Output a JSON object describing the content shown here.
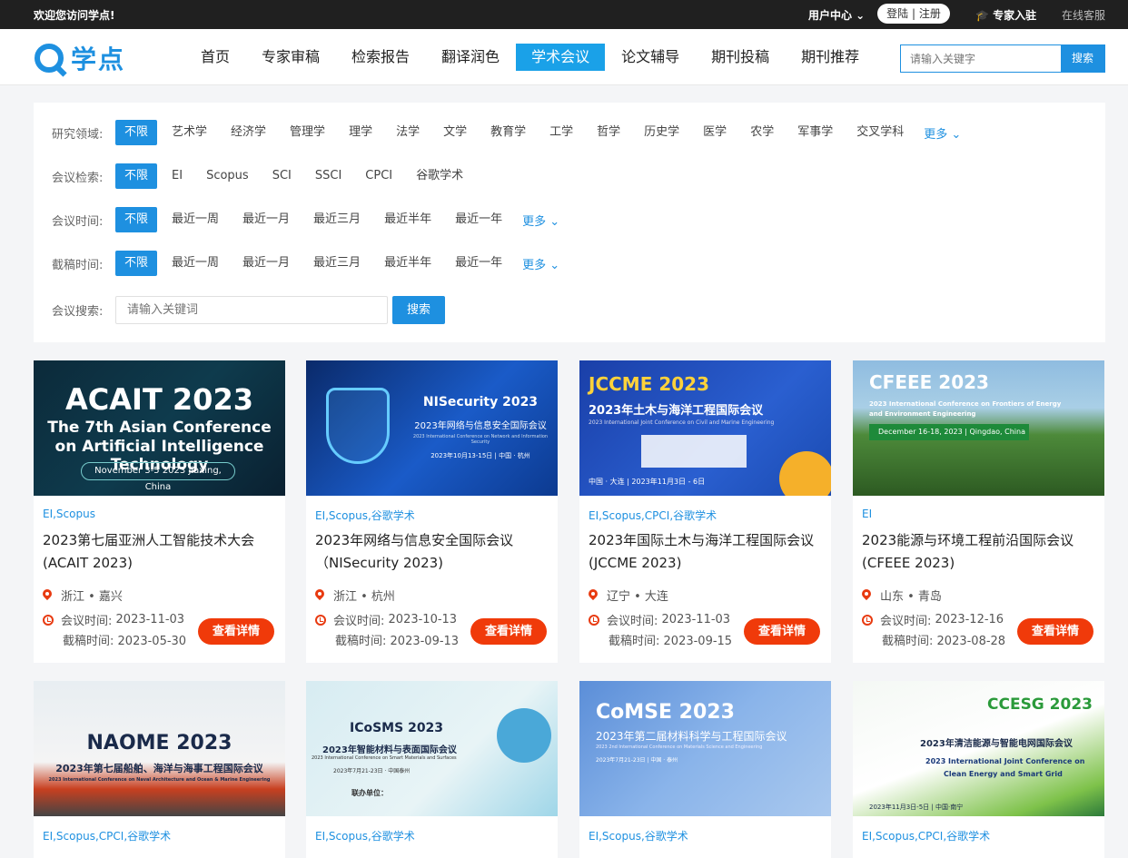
{
  "topbar": {
    "welcome": "欢迎您访问学点!",
    "user_center": "用户中心 ⌄",
    "login": "登陆",
    "register": "注册",
    "expert": "专家入驻",
    "service": "在线客服"
  },
  "header": {
    "logo_text": "学点",
    "nav": [
      "首页",
      "专家审稿",
      "检索报告",
      "翻译润色",
      "学术会议",
      "论文辅导",
      "期刊投稿",
      "期刊推荐"
    ],
    "active_nav": "学术会议",
    "search_placeholder": "请输入关键字",
    "search_button": "搜索"
  },
  "filters": {
    "field": {
      "label": "研究领域:",
      "options": [
        "不限",
        "艺术学",
        "经济学",
        "管理学",
        "理学",
        "法学",
        "文学",
        "教育学",
        "工学",
        "哲学",
        "历史学",
        "医学",
        "农学",
        "军事学",
        "交叉学科"
      ],
      "more": "更多 ⌄"
    },
    "index": {
      "label": "会议检索:",
      "options": [
        "不限",
        "EI",
        "Scopus",
        "SCI",
        "SSCI",
        "CPCI",
        "谷歌学术"
      ]
    },
    "mtime": {
      "label": "会议时间:",
      "options": [
        "不限",
        "最近一周",
        "最近一月",
        "最近三月",
        "最近半年",
        "最近一年"
      ],
      "more": "更多 ⌄"
    },
    "dtime": {
      "label": "截稿时间:",
      "options": [
        "不限",
        "最近一周",
        "最近一月",
        "最近三月",
        "最近半年",
        "最近一年"
      ],
      "more": "更多 ⌄"
    },
    "search": {
      "label": "会议搜索:",
      "placeholder": "请输入关键词",
      "button": "搜索"
    }
  },
  "labels": {
    "mtime": "会议时间:",
    "dtime": "截稿时间:",
    "detail": "查看详情"
  },
  "cards": [
    {
      "banner_title": "ACAIT 2023",
      "banner_sub": "The 7th Asian Conference",
      "banner_sub2": "on Artificial Intelligence Technology",
      "banner_date": "November 3-5 2023 Jiaxing, China",
      "tags": "EI,Scopus",
      "title": "2023第七届亚洲人工智能技术大会(ACAIT 2023)",
      "location": "浙江 • 嘉兴",
      "mdate": "2023-11-03",
      "ddate": "2023-05-30"
    },
    {
      "banner_title": "NISecurity 2023",
      "banner_sub": "2023年网络与信息安全国际会议",
      "banner_sub2": "2023 International Conference on Network and Information Security",
      "banner_date": "2023年10月13-15日 | 中国 · 杭州",
      "tags": "EI,Scopus,谷歌学术",
      "title": "2023年网络与信息安全国际会议（NISecurity 2023)",
      "location": "浙江 • 杭州",
      "mdate": "2023-10-13",
      "ddate": "2023-09-13"
    },
    {
      "banner_title": "JCCME 2023",
      "banner_sub": "2023年土木与海洋工程国际会议",
      "banner_sub2": "2023 International Joint Conference on Civil and Marine Engineering",
      "banner_date": "中国 · 大连 | 2023年11月3日 - 6日",
      "tags": "EI,Scopus,CPCI,谷歌学术",
      "title": "2023年国际土木与海洋工程国际会议 (JCCME 2023)",
      "location": "辽宁 • 大连",
      "mdate": "2023-11-03",
      "ddate": "2023-09-15"
    },
    {
      "banner_title": "CFEEE 2023",
      "banner_sub": "2023 International Conference on Frontiers of Energy",
      "banner_sub2": "and Environment Engineering",
      "banner_date": "December 16-18, 2023 | Qingdao, China",
      "tags": "EI",
      "title": "2023能源与环境工程前沿国际会议 (CFEEE 2023)",
      "location": "山东 • 青岛",
      "mdate": "2023-12-16",
      "ddate": "2023-08-28"
    },
    {
      "banner_title": "NAOME 2023",
      "banner_sub": "2023年第七届船舶、海洋与海事工程国际会议",
      "banner_sub2": "2023 International Conference on Naval Architecture and Ocean & Marine Engineering",
      "tags": "EI,Scopus,CPCI,谷歌学术"
    },
    {
      "banner_title": "ICoSMS 2023",
      "banner_sub": "2023年智能材料与表面国际会议",
      "banner_sub2": "2023 International Conference on Smart Materials and Surfaces",
      "banner_date": "2023年7月21-23日 · 中国泰州",
      "banner_extra": "联办单位：",
      "tags": "EI,Scopus,谷歌学术"
    },
    {
      "banner_title": "CoMSE 2023",
      "banner_sub": "2023年第二届材料科学与工程国际会议",
      "banner_sub2": "2023 2nd International Conference on Materials Science and Engineering",
      "banner_date": "2023年7月21-23日 | 中国 · 泰州",
      "tags": "EI,Scopus,谷歌学术"
    },
    {
      "banner_title": "CCESG 2023",
      "banner_sub": "2023年清洁能源与智能电网国际会议",
      "banner_sub2": "2023 International Joint Conference on",
      "banner_sub3": "Clean Energy and Smart Grid",
      "banner_date": "2023年11月3日-5日 | 中国·南宁",
      "tags": "EI,Scopus,CPCI,谷歌学术"
    }
  ]
}
